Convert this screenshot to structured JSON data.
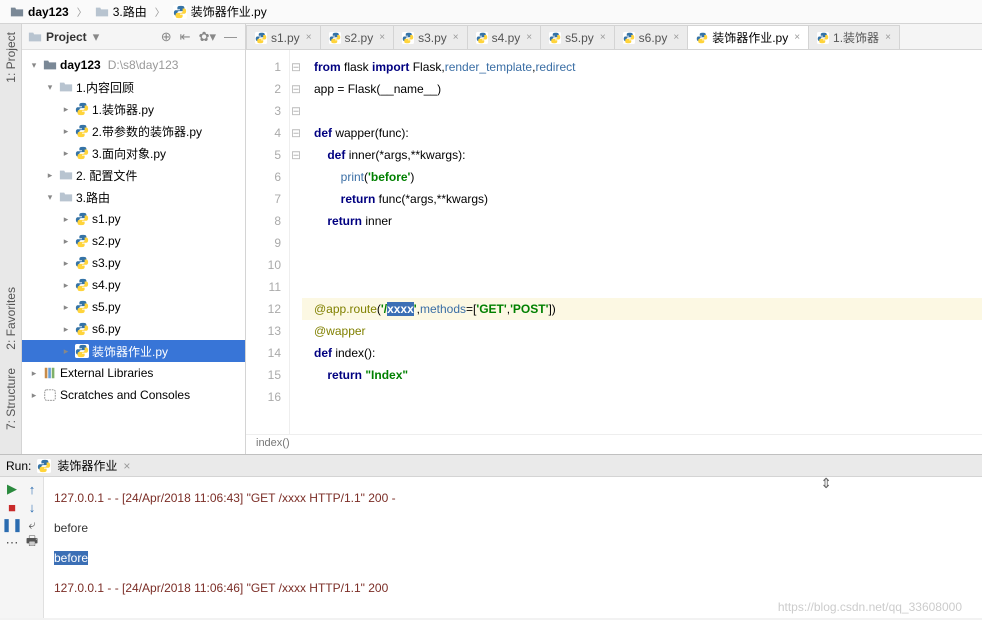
{
  "breadcrumb": [
    "day123",
    "3.路由",
    "装饰器作业.py"
  ],
  "sidebar": {
    "title": "Project",
    "root": {
      "label": "day123",
      "hint": "D:\\s8\\day123"
    },
    "tree": [
      {
        "d": 1,
        "t": "v",
        "icon": "dir",
        "label": "1.内容回顾"
      },
      {
        "d": 2,
        "t": ">",
        "icon": "py",
        "label": "1.装饰器.py"
      },
      {
        "d": 2,
        "t": ">",
        "icon": "py",
        "label": "2.带参数的装饰器.py"
      },
      {
        "d": 2,
        "t": ">",
        "icon": "py",
        "label": "3.面向对象.py"
      },
      {
        "d": 1,
        "t": ">",
        "icon": "dir",
        "label": "2. 配置文件"
      },
      {
        "d": 1,
        "t": "v",
        "icon": "dir",
        "label": "3.路由"
      },
      {
        "d": 2,
        "t": ">",
        "icon": "py",
        "label": "s1.py"
      },
      {
        "d": 2,
        "t": ">",
        "icon": "py",
        "label": "s2.py"
      },
      {
        "d": 2,
        "t": ">",
        "icon": "py",
        "label": "s3.py"
      },
      {
        "d": 2,
        "t": ">",
        "icon": "py",
        "label": "s4.py"
      },
      {
        "d": 2,
        "t": ">",
        "icon": "py",
        "label": "s5.py"
      },
      {
        "d": 2,
        "t": ">",
        "icon": "py",
        "label": "s6.py"
      },
      {
        "d": 2,
        "t": ">",
        "icon": "py",
        "label": "装饰器作业.py",
        "sel": true
      }
    ],
    "extra": [
      {
        "icon": "lib",
        "label": "External Libraries"
      },
      {
        "icon": "scratch",
        "label": "Scratches and Consoles"
      }
    ]
  },
  "tabs": [
    {
      "label": "s1.py"
    },
    {
      "label": "s2.py"
    },
    {
      "label": "s3.py"
    },
    {
      "label": "s4.py"
    },
    {
      "label": "s5.py"
    },
    {
      "label": "s6.py"
    },
    {
      "label": "装饰器作业.py",
      "active": true
    },
    {
      "label": "1.装饰器"
    }
  ],
  "code": {
    "lines": [
      {
        "n": 1,
        "html": "<span class='kw'>from</span> flask <span class='kw'>import</span> Flask,<span class='bi'>render_template</span>,<span class='bi'>redirect</span>"
      },
      {
        "n": 2,
        "html": "app = Flask(__name__)"
      },
      {
        "n": 3,
        "html": ""
      },
      {
        "n": 4,
        "html": "<span class='kw'>def</span> <span class='fn'>wapper</span>(func):"
      },
      {
        "n": 5,
        "html": "    <span class='kw'>def</span> <span class='fn'>inner</span>(*args,**kwargs):"
      },
      {
        "n": 6,
        "html": "        <span class='bi'>print</span>(<span class='str'>'before'</span>)"
      },
      {
        "n": 7,
        "html": "        <span class='kw'>return</span> func(*args,**kwargs)"
      },
      {
        "n": 8,
        "html": "    <span class='kw'>return</span> inner"
      },
      {
        "n": 9,
        "html": ""
      },
      {
        "n": 10,
        "html": ""
      },
      {
        "n": 11,
        "html": ""
      },
      {
        "n": 12,
        "hl": true,
        "html": "<span class='dec'>@app.route</span>(<span class='str'>'/<span class='sel-text'>xxxx</span>'</span>,<span class='bi'>methods</span>=[<span class='str'>'GET'</span>,<span class='str'>'POST'</span>])"
      },
      {
        "n": 13,
        "html": "<span class='dec'>@wapper</span>"
      },
      {
        "n": 14,
        "html": "<span class='kw'>def</span> <span class='fn'>index</span>():"
      },
      {
        "n": 15,
        "html": "    <span class='kw'>return</span> <span class='str'>\"Index\"</span>"
      },
      {
        "n": 16,
        "html": ""
      }
    ],
    "breadcrumb": "index()"
  },
  "run": {
    "tab": "装饰器作业",
    "label": "Run:",
    "lines": [
      {
        "cls": "log",
        "text": "127.0.0.1 - - [24/Apr/2018 11:06:43] \"GET /xxxx HTTP/1.1\" 200 -"
      },
      {
        "cls": "txt",
        "text": "before"
      },
      {
        "cls": "txt",
        "html": "<span class='selc'>before</span>"
      },
      {
        "cls": "log",
        "text": "127.0.0.1 - - [24/Apr/2018 11:06:46] \"GET /xxxx HTTP/1.1\" 200"
      }
    ]
  },
  "leftRail": [
    "1: Project",
    "2: Favorites",
    "7: Structure"
  ],
  "watermark": "https://blog.csdn.net/qq_33608000"
}
